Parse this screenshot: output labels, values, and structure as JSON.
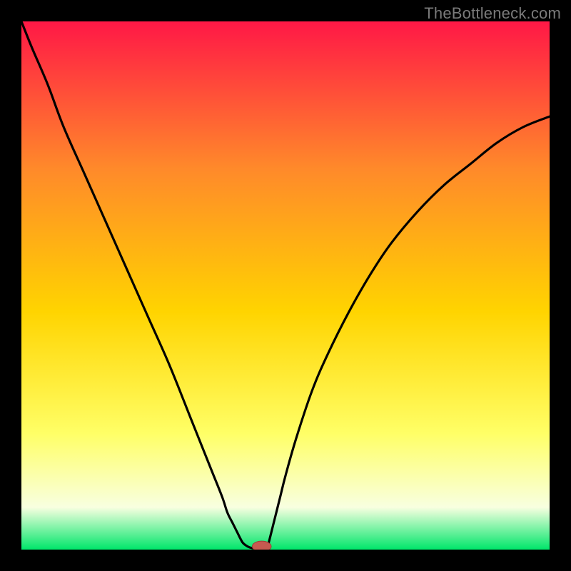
{
  "watermark": "TheBottleneck.com",
  "colors": {
    "gradient_top": "#ff1846",
    "gradient_mid_upper": "#ff8a2a",
    "gradient_mid": "#ffd400",
    "gradient_mid_lower": "#ffff66",
    "gradient_pale": "#f8ffe0",
    "gradient_bottom": "#00e66a",
    "curve": "#000000",
    "marker_fill": "#c65a50",
    "marker_stroke": "#9c3f38",
    "frame": "#000000"
  },
  "chart_data": {
    "type": "line",
    "title": "",
    "xlabel": "",
    "ylabel": "",
    "x_range": [
      0,
      100
    ],
    "y_range": [
      0,
      100
    ],
    "series": [
      {
        "name": "left-branch",
        "x": [
          0,
          2,
          5,
          8,
          12,
          16,
          20,
          24,
          28,
          32,
          34,
          36,
          38,
          39,
          40,
          41,
          41.5,
          42,
          43,
          44,
          44.5
        ],
        "y": [
          100,
          95,
          88,
          80,
          71,
          62,
          53,
          44,
          35,
          25,
          20,
          15,
          10,
          7,
          5,
          3,
          2,
          1.2,
          0.5,
          0.2,
          0
        ]
      },
      {
        "name": "right-branch",
        "x": [
          46.5,
          47,
          48,
          49,
          50,
          52,
          55,
          58,
          62,
          66,
          70,
          75,
          80,
          85,
          90,
          95,
          100
        ],
        "y": [
          0,
          2,
          6,
          10,
          14,
          21,
          30,
          37,
          45,
          52,
          58,
          64,
          69,
          73,
          77,
          80,
          82
        ]
      },
      {
        "name": "floor",
        "x": [
          44.5,
          46.5
        ],
        "y": [
          0,
          0
        ]
      }
    ],
    "marker": {
      "x": 45.5,
      "y": 0.6,
      "rx": 1.8,
      "ry": 1.0
    },
    "grid": false,
    "legend": false
  }
}
